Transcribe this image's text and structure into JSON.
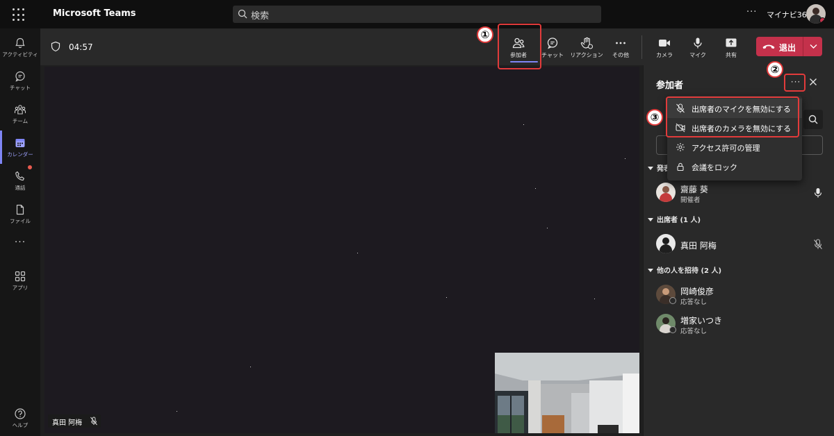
{
  "app": {
    "title": "Microsoft Teams",
    "search_placeholder": "検索",
    "more": "···",
    "tenant": "マイナビ365"
  },
  "rail": {
    "items": [
      {
        "label": "アクティビティ",
        "icon": "bell-icon"
      },
      {
        "label": "チャット",
        "icon": "chat-icon"
      },
      {
        "label": "チーム",
        "icon": "teams-icon"
      },
      {
        "label": "カレンダー",
        "icon": "calendar-icon",
        "active": true
      },
      {
        "label": "通話",
        "icon": "phone-icon",
        "badge": true
      },
      {
        "label": "ファイル",
        "icon": "file-icon"
      },
      {
        "label": "アプリ",
        "icon": "apps-icon"
      },
      {
        "label": "ヘルプ",
        "icon": "help-icon"
      }
    ],
    "more": "···"
  },
  "meeting": {
    "timer": "04:57",
    "toolbar": {
      "participants": "参加者",
      "chat": "チャット",
      "reactions": "リアクション",
      "more": "その他",
      "camera": "カメラ",
      "mic": "マイク",
      "share": "共有",
      "leave": "退出"
    },
    "name_tag": "真田 阿梅"
  },
  "panel": {
    "title": "参加者",
    "more": "···",
    "sections": [
      {
        "label": "発表者",
        "people": [
          {
            "name": "齋藤 葵",
            "role": "開催者",
            "mic": "on"
          }
        ]
      },
      {
        "label": "出席者 (1 人)",
        "people": [
          {
            "name": "真田 阿梅",
            "mic": "muted"
          }
        ]
      },
      {
        "label": "他の人を招待 (2 人)",
        "people": [
          {
            "name": "岡崎俊彦",
            "status": "応答なし"
          },
          {
            "name": "増家いつき",
            "status": "応答なし"
          }
        ]
      }
    ]
  },
  "menu": {
    "items": [
      {
        "label": "出席者のマイクを無効にする",
        "icon": "mic-off-icon"
      },
      {
        "label": "出席者のカメラを無効にする",
        "icon": "camera-off-icon"
      },
      {
        "label": "アクセス許可の管理",
        "icon": "gear-icon"
      },
      {
        "label": "会議をロック",
        "icon": "lock-icon"
      }
    ]
  },
  "annotations": [
    "①",
    "②",
    "③"
  ],
  "colors": {
    "accent": "#7f85f5",
    "leave": "#c4314b",
    "annotation": "#e23b3b"
  }
}
